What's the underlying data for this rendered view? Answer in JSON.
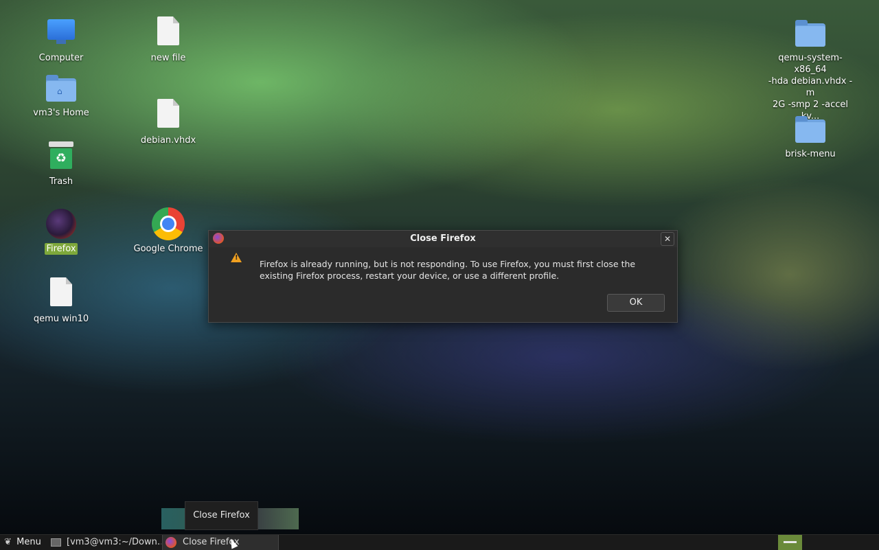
{
  "desktop": {
    "icons": [
      {
        "label": "Computer",
        "icon": "computer-icon"
      },
      {
        "label": "vm3's Home",
        "icon": "home-folder-icon"
      },
      {
        "label": "Trash",
        "icon": "trash-icon"
      },
      {
        "label": "Firefox",
        "icon": "firefox-icon",
        "selected": true
      },
      {
        "label": "qemu win10",
        "icon": "file-icon"
      },
      {
        "label": "new file",
        "icon": "file-icon"
      },
      {
        "label": "debian.vhdx",
        "icon": "file-icon"
      },
      {
        "label": "Google Chrome",
        "icon": "chrome-icon"
      },
      {
        "label": "qemu-system-x86_64\n-hda debian.vhdx -m\n2G -smp 2 -accel kv...",
        "icon": "folder-icon"
      },
      {
        "label": "brisk-menu",
        "icon": "folder-icon"
      }
    ]
  },
  "dialog": {
    "title": "Close Firefox",
    "message": "Firefox is already running, but is not responding. To use Firefox, you must first close the existing Firefox process, restart your device, or use a different profile.",
    "ok_label": "OK",
    "close_glyph": "✕",
    "warning_glyph": "!"
  },
  "tooltip": {
    "text": "Close Firefox"
  },
  "taskbar": {
    "menu_label": "Menu",
    "tasks": [
      {
        "label": "[vm3@vm3:~/Down…",
        "icon": "terminal-icon"
      },
      {
        "label": "Close Firefox",
        "icon": "firefox-icon",
        "active": true
      }
    ]
  },
  "colors": {
    "selection": "#7ea83b",
    "dialog_bg": "#2b2b2b",
    "warning": "#f0a020",
    "tray_indicator": "#6a8a3a"
  }
}
